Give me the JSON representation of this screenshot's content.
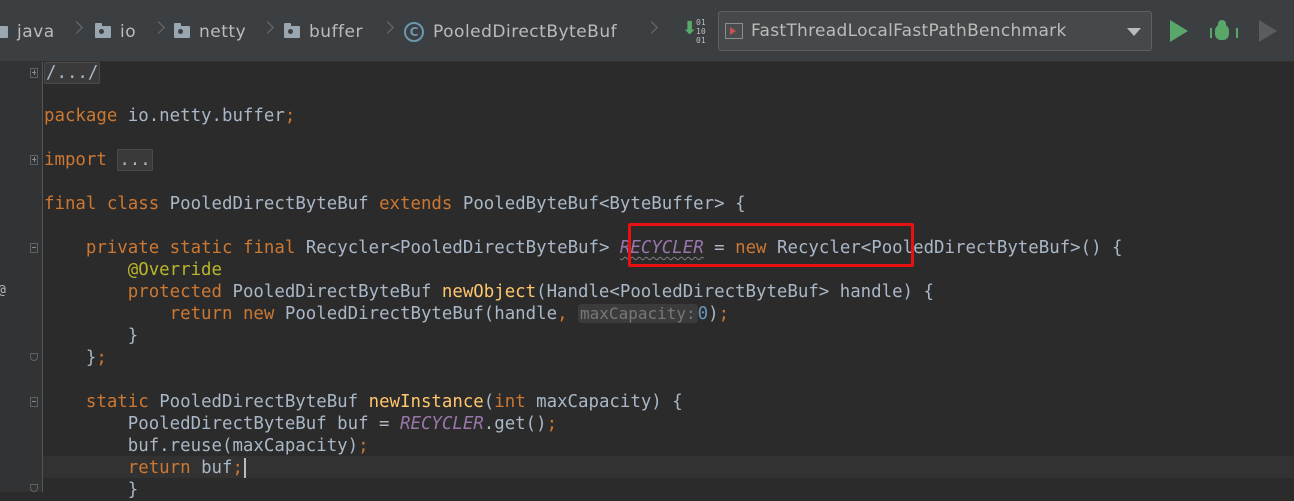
{
  "breadcrumbs": [
    {
      "label": "java"
    },
    {
      "label": "io"
    },
    {
      "label": "netty"
    },
    {
      "label": "buffer"
    },
    {
      "label": "PooledDirectByteBuf",
      "icon_letter": "C"
    }
  ],
  "toolbar": {
    "build_bits": [
      "01",
      "10",
      "01"
    ],
    "run_config": "FastThreadLocalFastPathBenchmark"
  },
  "gutter": {
    "override_marker": "@"
  },
  "code": {
    "header_fold": "/.../",
    "package_kw": "package",
    "package_name": " io.netty.buffer",
    "semi": ";",
    "import_kw": "import",
    "import_folded": "...",
    "l4_final": "final",
    "l4_class": "class",
    "l4_name": " PooledDirectByteBuf ",
    "l4_extends": "extends",
    "l4_rest": " PooledByteBuf<ByteBuffer> {",
    "l5_private": "private",
    "l5_static": "static",
    "l5_final": "final",
    "l5_type": " Recycler<PooledDirectByteBuf> ",
    "l5_field": "RECYCLER",
    "l5_eq": " = ",
    "l5_new": "new",
    "l5_rest": " Recycler<PooledDirectByteBuf>() {",
    "l6_annotation": "@Override",
    "l7_protected": "protected",
    "l7_type": " PooledDirectByteBuf ",
    "l7_method": "newObject",
    "l7_rest": "(Handle<PooledDirectByteBuf> handle) {",
    "l8_return": "return",
    "l8_new": "new",
    "l8_call": " PooledDirectByteBuf(handle",
    "l8_comma": ", ",
    "l8_hint": "maxCapacity:",
    "l8_num": "0",
    "l8_close": ")",
    "brace_close": "}",
    "l10_close": "}",
    "l11_static": "static",
    "l11_type": " PooledDirectByteBuf ",
    "l11_method": "newInstance",
    "l11_paren": "(",
    "l11_int": "int",
    "l11_rest": " maxCapacity) {",
    "l12_decl": "PooledDirectByteBuf buf = ",
    "l12_field": "RECYCLER",
    "l12_rest": ".get()",
    "l13_call": "buf.reuse(maxCapacity)",
    "l14_return": "return",
    "l14_rest": " buf",
    "l15_close": "}"
  }
}
